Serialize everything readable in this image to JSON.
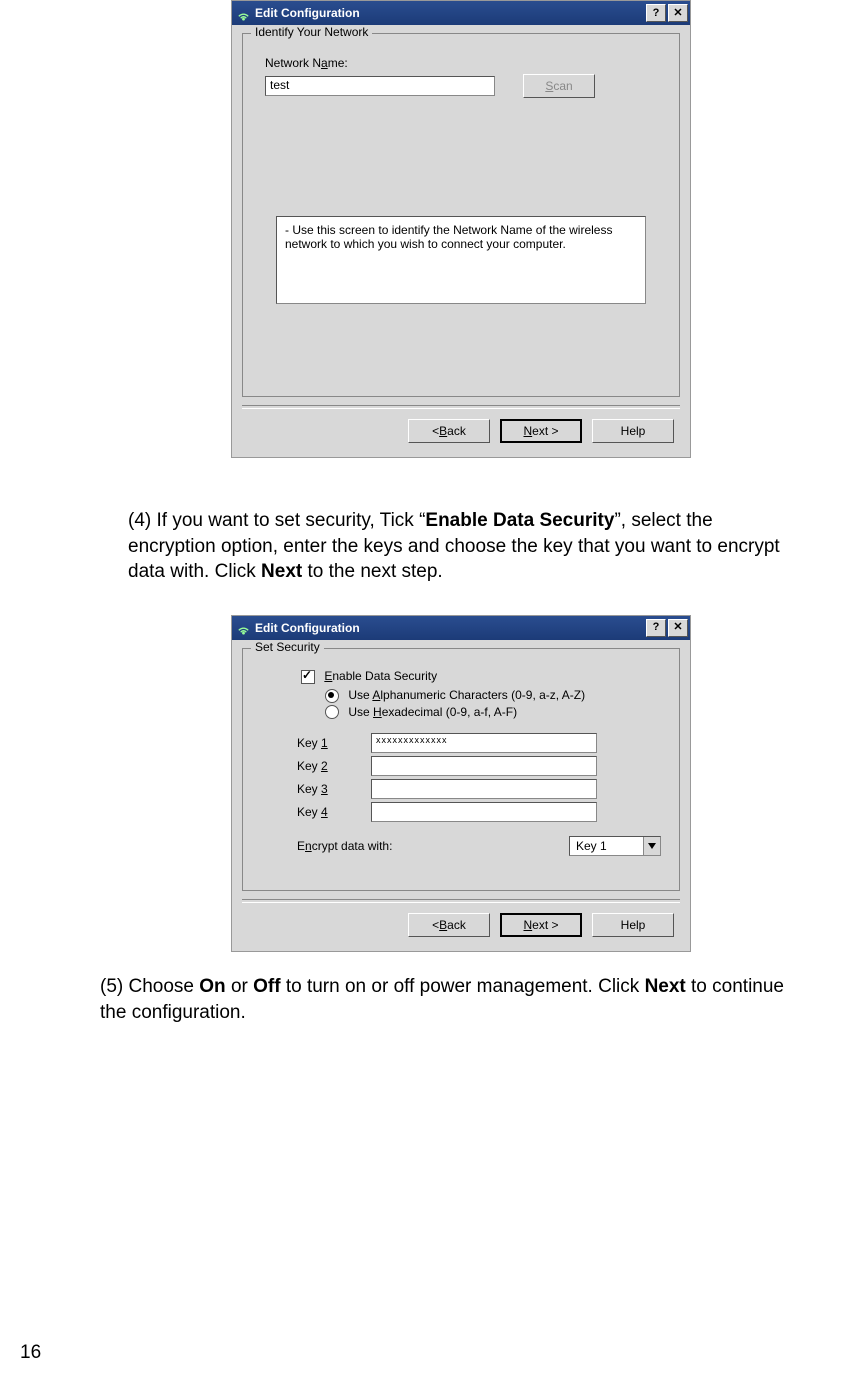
{
  "page_number": "16",
  "dlg1": {
    "title": "Edit Configuration",
    "groupLegend": "Identify Your Network",
    "nameLabelPrefix": "Network N",
    "nameLabelUL": "a",
    "nameLabelSuffix": "me:",
    "nameValue": "test",
    "scanBtnUL": "S",
    "scanBtnSuffix": "can",
    "helpText": "-  Use this screen to identify the Network Name of the wireless network to which you wish to connect your computer.",
    "backPrefix": "< ",
    "backUL": "B",
    "backSuffix": "ack",
    "nextUL": "N",
    "nextSuffix": "ext >",
    "help": "Help"
  },
  "para4": {
    "prefix": "(4) If you want to set security, Tick “",
    "bold1": "Enable Data Security",
    "mid": "”, select the encryption option, enter the keys and choose the key that you want to encrypt data with. Click ",
    "bold2": "Next",
    "suffix": " to the next step."
  },
  "dlg2": {
    "title": "Edit Configuration",
    "groupLegend": "Set Security",
    "enableUL": "E",
    "enableSuffix": "nable Data Security",
    "alphaPrefix": "Use ",
    "alphaUL": "A",
    "alphaSuffix": "lphanumeric Characters (0-9, a-z, A-Z)",
    "hexPrefix": "Use ",
    "hexUL": "H",
    "hexSuffix": "exadecimal (0-9, a-f, A-F)",
    "key1Prefix": "Key ",
    "key1UL": "1",
    "key2Prefix": "Key ",
    "key2UL": "2",
    "key3Prefix": "Key ",
    "key3UL": "3",
    "key4Prefix": "Key ",
    "key4UL": "4",
    "key1Value": "xxxxxxxxxxxxx",
    "encryptPrefix": "E",
    "encryptUL": "n",
    "encryptSuffix": "crypt data with:",
    "ddValue": "Key 1",
    "backPrefix": "< ",
    "backUL": "B",
    "backSuffix": "ack",
    "nextUL": "N",
    "nextSuffix": "ext >",
    "help": "Help"
  },
  "para5": {
    "prefix": "(5) Choose ",
    "bold1": "On",
    "mid1": " or ",
    "bold2": "Off",
    "mid2": " to turn on or off power management. Click ",
    "bold3": "Next",
    "suffix": " to continue the configuration."
  }
}
